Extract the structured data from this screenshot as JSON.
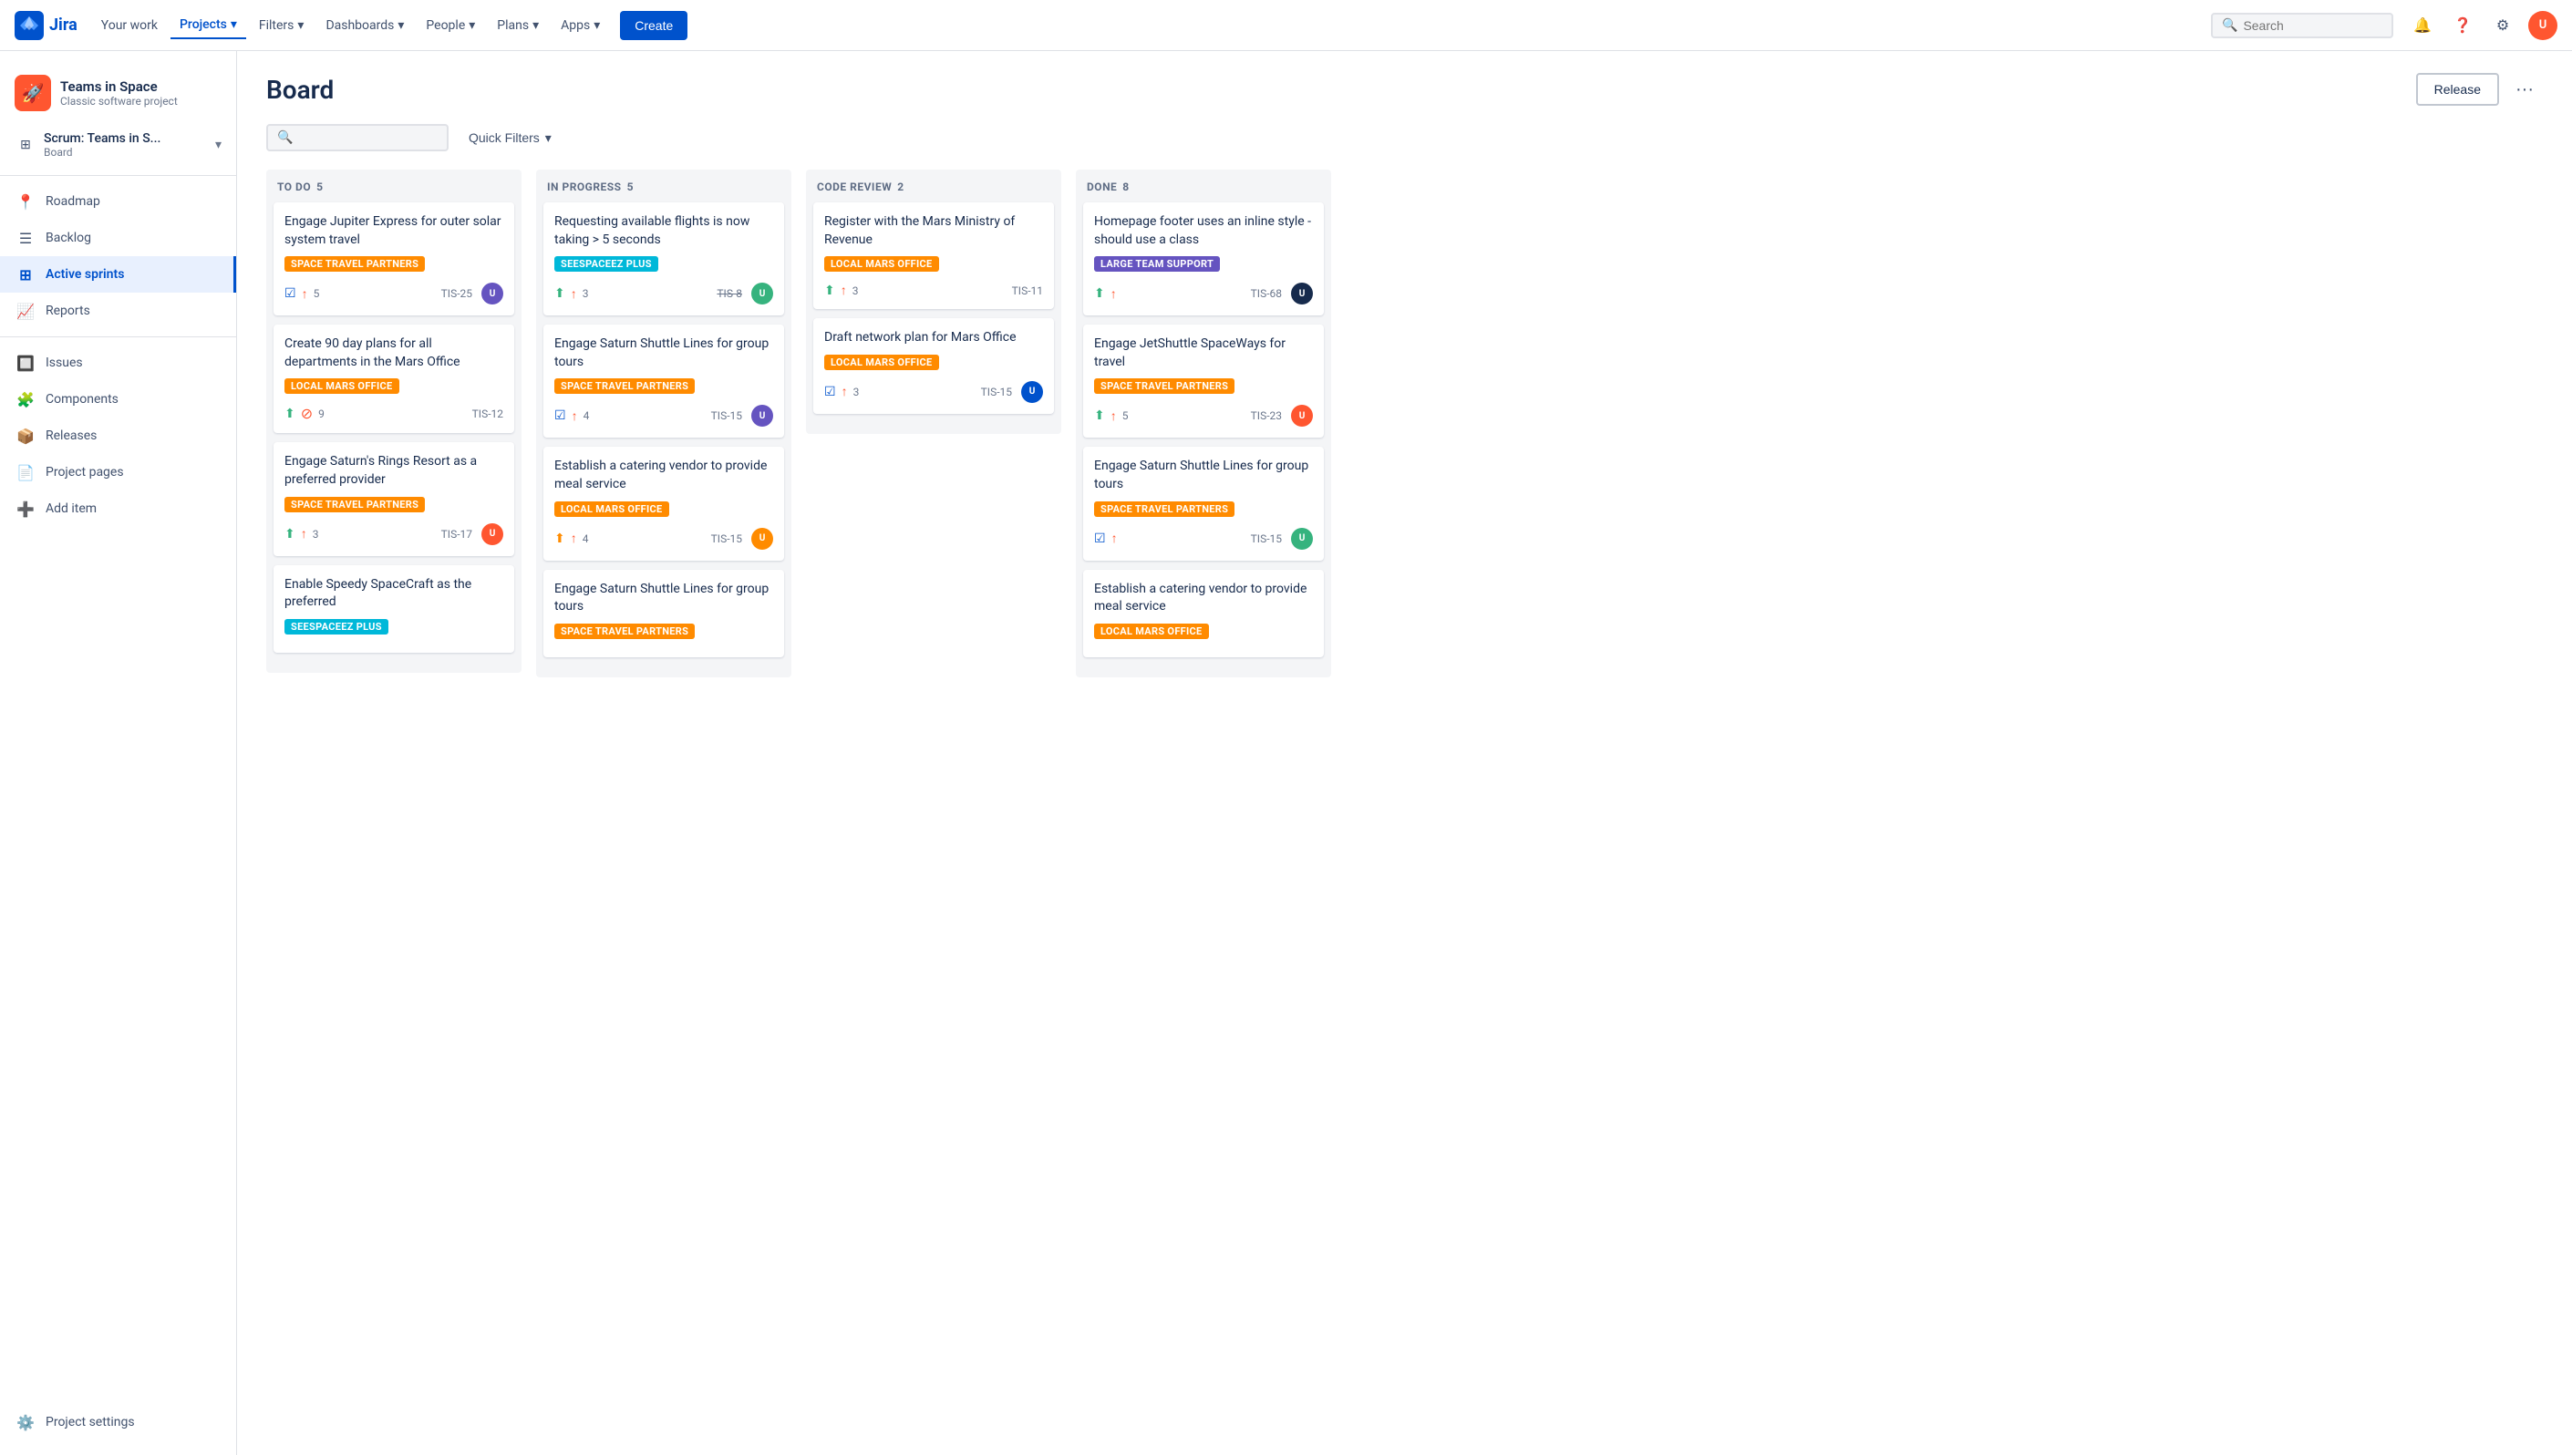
{
  "topnav": {
    "logo_text": "Jira",
    "nav_items": [
      {
        "id": "your-work",
        "label": "Your work"
      },
      {
        "id": "projects",
        "label": "Projects",
        "has_chevron": true,
        "active": true
      },
      {
        "id": "filters",
        "label": "Filters",
        "has_chevron": true
      },
      {
        "id": "dashboards",
        "label": "Dashboards",
        "has_chevron": true
      },
      {
        "id": "people",
        "label": "People",
        "has_chevron": true
      },
      {
        "id": "plans",
        "label": "Plans",
        "has_chevron": true
      },
      {
        "id": "apps",
        "label": "Apps",
        "has_chevron": true
      }
    ],
    "create_label": "Create",
    "search_placeholder": "Search",
    "avatar_initials": "U"
  },
  "sidebar": {
    "project_name": "Teams in Space",
    "project_subtitle": "Classic software project",
    "board_label": "Scrum: Teams in S...",
    "board_sublabel": "Board",
    "nav_items": [
      {
        "id": "roadmap",
        "label": "Roadmap",
        "icon": "📍"
      },
      {
        "id": "backlog",
        "label": "Backlog",
        "icon": "☰"
      },
      {
        "id": "active-sprints",
        "label": "Active sprints",
        "icon": "⊞",
        "active": true
      },
      {
        "id": "reports",
        "label": "Reports",
        "icon": "📈"
      },
      {
        "id": "issues",
        "label": "Issues",
        "icon": "🔲"
      },
      {
        "id": "components",
        "label": "Components",
        "icon": "🧩"
      },
      {
        "id": "releases",
        "label": "Releases",
        "icon": "📦"
      },
      {
        "id": "project-pages",
        "label": "Project pages",
        "icon": "📄"
      },
      {
        "id": "add-item",
        "label": "Add item",
        "icon": "➕"
      },
      {
        "id": "project-settings",
        "label": "Project settings",
        "icon": "⚙️"
      }
    ]
  },
  "board": {
    "title": "Board",
    "release_label": "Release",
    "more_label": "···",
    "search_placeholder": "",
    "quick_filters_label": "Quick Filters",
    "columns": [
      {
        "id": "todo",
        "label": "TO DO",
        "count": 5,
        "cards": [
          {
            "title": "Engage Jupiter Express for outer solar system travel",
            "tag": "SPACE TRAVEL PARTNERS",
            "tag_class": "tag-orange",
            "icon1": "☑",
            "icon1_class": "icon-checkbox",
            "icon2": "↑",
            "icon2_class": "icon-up-arrow",
            "count": "5",
            "id": "TIS-25",
            "id_strikethrough": false,
            "avatar": "U1"
          },
          {
            "title": "Create 90 day plans for all departments in the Mars Office",
            "tag": "LOCAL MARS OFFICE",
            "tag_class": "tag-orange",
            "icon1": "⬆",
            "icon1_class": "icon-story",
            "icon2": "⊘",
            "icon2_class": "icon-block",
            "count": "9",
            "id": "TIS-12",
            "id_strikethrough": false,
            "avatar": ""
          },
          {
            "title": "Engage Saturn's Rings Resort as a preferred provider",
            "tag": "SPACE TRAVEL PARTNERS",
            "tag_class": "tag-orange",
            "icon1": "⬆",
            "icon1_class": "icon-story",
            "icon2": "↑",
            "icon2_class": "icon-up-arrow",
            "count": "3",
            "id": "TIS-17",
            "id_strikethrough": false,
            "avatar": "U2"
          },
          {
            "title": "Enable Speedy SpaceCraft as the preferred",
            "tag": "SEESPACEEZ PLUS",
            "tag_class": "tag-teal",
            "icon1": "",
            "icon1_class": "",
            "icon2": "",
            "icon2_class": "",
            "count": "",
            "id": "",
            "id_strikethrough": false,
            "avatar": ""
          }
        ]
      },
      {
        "id": "in-progress",
        "label": "IN PROGRESS",
        "count": 5,
        "cards": [
          {
            "title": "Requesting available flights is now taking > 5 seconds",
            "tag": "SEESPACEEZ PLUS",
            "tag_class": "tag-teal",
            "icon1": "⬆",
            "icon1_class": "icon-story",
            "icon2": "↑",
            "icon2_class": "icon-up-arrow",
            "count": "3",
            "id": "TIS-8",
            "id_strikethrough": true,
            "avatar": "U3"
          },
          {
            "title": "Engage Saturn Shuttle Lines for group tours",
            "tag": "SPACE TRAVEL PARTNERS",
            "tag_class": "tag-orange",
            "icon1": "☑",
            "icon1_class": "icon-checkbox",
            "icon2": "↑",
            "icon2_class": "icon-up-arrow",
            "count": "4",
            "id": "TIS-15",
            "id_strikethrough": false,
            "avatar": "U4"
          },
          {
            "title": "Establish a catering vendor to provide meal service",
            "tag": "LOCAL MARS OFFICE",
            "tag_class": "tag-orange",
            "icon1": "⬆",
            "icon1_class": "icon-story",
            "icon2": "↑",
            "icon2_class": "icon-up-arrow",
            "count": "4",
            "id": "TIS-15",
            "id_strikethrough": false,
            "avatar": "U5"
          },
          {
            "title": "Engage Saturn Shuttle Lines for group tours",
            "tag": "SPACE TRAVEL PARTNERS",
            "tag_class": "tag-orange",
            "icon1": "",
            "icon1_class": "",
            "icon2": "",
            "icon2_class": "",
            "count": "",
            "id": "",
            "id_strikethrough": false,
            "avatar": ""
          }
        ]
      },
      {
        "id": "code-review",
        "label": "CODE REVIEW",
        "count": 2,
        "cards": [
          {
            "title": "Register with the Mars Ministry of Revenue",
            "tag": "LOCAL MARS OFFICE",
            "tag_class": "tag-orange",
            "icon1": "⬆",
            "icon1_class": "icon-story",
            "icon2": "↑",
            "icon2_class": "icon-up-arrow",
            "count": "3",
            "id": "TIS-11",
            "id_strikethrough": false,
            "avatar": ""
          },
          {
            "title": "Draft network plan for Mars Office",
            "tag": "LOCAL MARS OFFICE",
            "tag_class": "tag-orange",
            "icon1": "☑",
            "icon1_class": "icon-checkbox",
            "icon2": "↑",
            "icon2_class": "icon-up-arrow",
            "count": "3",
            "id": "TIS-15",
            "id_strikethrough": false,
            "avatar": "U6"
          }
        ]
      },
      {
        "id": "done",
        "label": "DONE",
        "count": 8,
        "cards": [
          {
            "title": "Homepage footer uses an inline style - should use a class",
            "tag": "LARGE TEAM SUPPORT",
            "tag_class": "tag-purple",
            "icon1": "⬆",
            "icon1_class": "icon-story",
            "icon2": "↑",
            "icon2_class": "icon-up-arrow",
            "count": "",
            "id": "TIS-68",
            "id_strikethrough": false,
            "avatar": "U7"
          },
          {
            "title": "Engage JetShuttle SpaceWays for travel",
            "tag": "SPACE TRAVEL PARTNERS",
            "tag_class": "tag-orange",
            "icon1": "⬆",
            "icon1_class": "icon-story",
            "icon2": "↑",
            "icon2_class": "icon-up-arrow",
            "count": "5",
            "id": "TIS-23",
            "id_strikethrough": false,
            "avatar": "U8"
          },
          {
            "title": "Engage Saturn Shuttle Lines for group tours",
            "tag": "SPACE TRAVEL PARTNERS",
            "tag_class": "tag-orange",
            "icon1": "☑",
            "icon1_class": "icon-checkbox",
            "icon2": "↑",
            "icon2_class": "icon-up-arrow",
            "count": "",
            "id": "TIS-15",
            "id_strikethrough": false,
            "avatar": "U9"
          },
          {
            "title": "Establish a catering vendor to provide meal service",
            "tag": "LOCAL MARS OFFICE",
            "tag_class": "tag-orange",
            "icon1": "",
            "icon1_class": "",
            "icon2": "",
            "icon2_class": "",
            "count": "",
            "id": "",
            "id_strikethrough": false,
            "avatar": ""
          }
        ]
      }
    ]
  },
  "avatars": {
    "U1": "#6554c0",
    "U2": "#ff5630",
    "U3": "#36b37e",
    "U4": "#6554c0",
    "U5": "#ff8b00",
    "U6": "#0052cc",
    "U7": "#172b4d",
    "U8": "#ff5630",
    "U9": "#36b37e"
  }
}
